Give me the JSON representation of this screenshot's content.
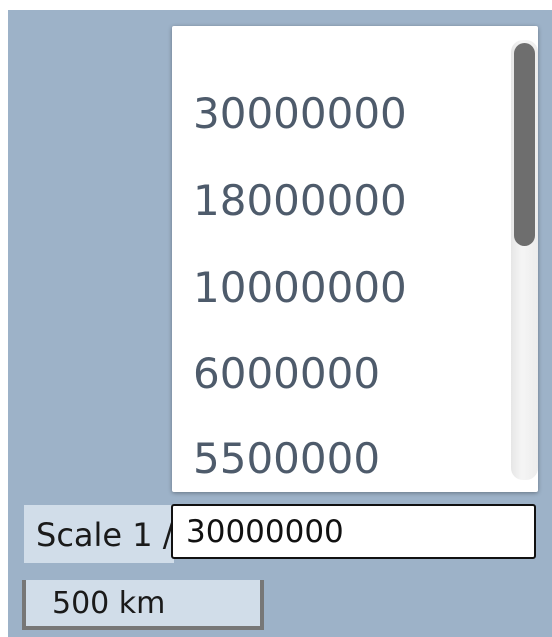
{
  "scale_dropdown": {
    "options": [
      "30000000",
      "18000000",
      "10000000",
      "6000000",
      "5500000"
    ]
  },
  "scale_control": {
    "label": "Scale 1 /",
    "value": "30000000"
  },
  "scale_bar": {
    "label": "500 km"
  },
  "colors": {
    "map_background": "#9db2c8",
    "control_background": "#d1dde9",
    "option_text": "#4e5b6b"
  }
}
